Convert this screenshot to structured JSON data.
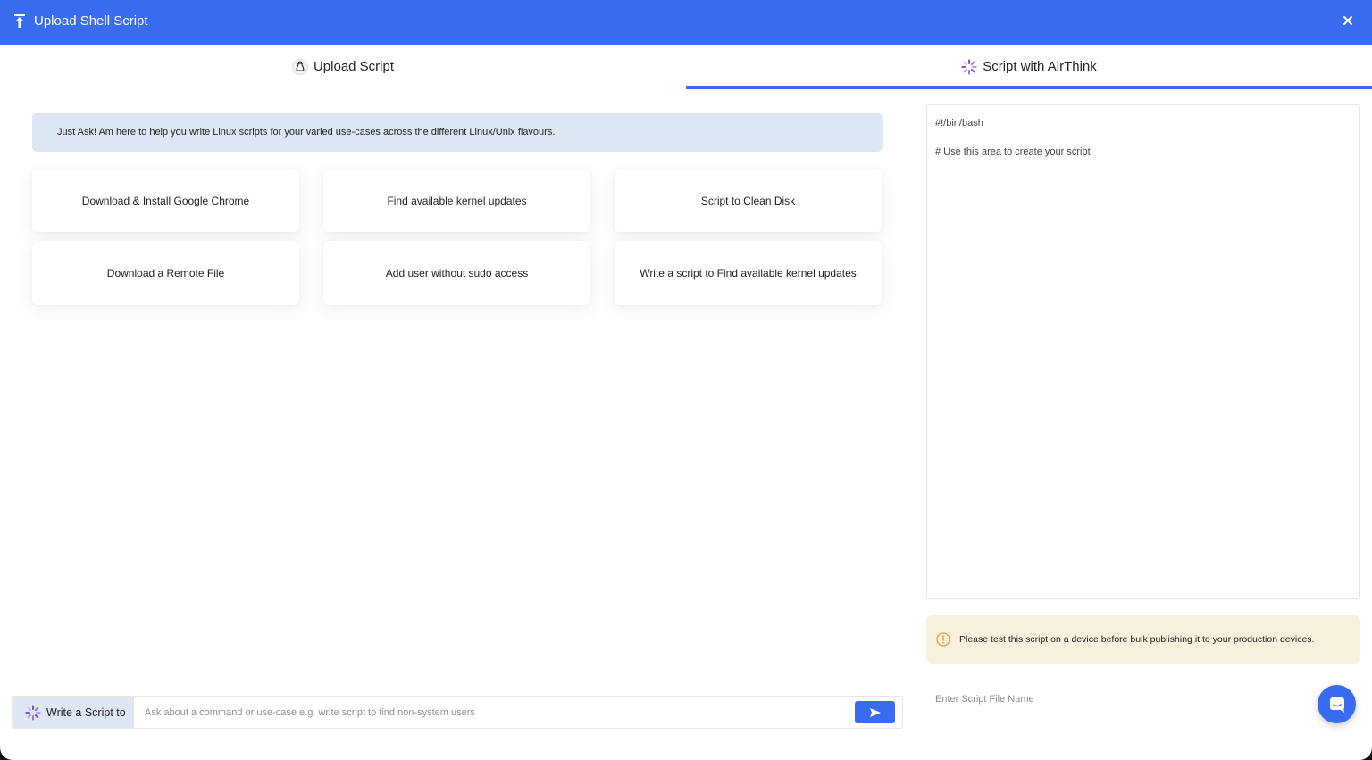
{
  "window": {
    "title": "Upload Shell Script",
    "accent_color": "#3a6cf0",
    "icons": {
      "upload": "upload-icon",
      "close": "close-icon"
    }
  },
  "tabs": [
    {
      "label": "Upload Script",
      "icon": "linux-penguin-icon",
      "active": false
    },
    {
      "label": "Script with AirThink",
      "icon": "airthink-spinner-icon",
      "active": true
    }
  ],
  "banner": {
    "text": "Just Ask! Am here to help you write Linux scripts for your varied use-cases across the different Linux/Unix flavours."
  },
  "suggestions": [
    "Download & Install Google Chrome",
    "Find available kernel updates",
    "Script to Clean Disk",
    "Download a Remote File",
    "Add user without sudo access",
    "Write a script to Find available kernel updates"
  ],
  "prompt_bar": {
    "label": "Write a Script to",
    "placeholder": "Ask about a command or use-case e.g. write script to find non-system users",
    "send_icon": "send-icon"
  },
  "editor": {
    "line1": "#!/bin/bash",
    "line2": "# Use this area to create your script"
  },
  "warning": {
    "text": "Please test this script on a device before bulk publishing it to your production devices.",
    "icon": "info-icon",
    "color": "#f7f0dc"
  },
  "filename": {
    "placeholder": "Enter Script File Name"
  },
  "chat_fab": {
    "icon": "chat-icon"
  }
}
